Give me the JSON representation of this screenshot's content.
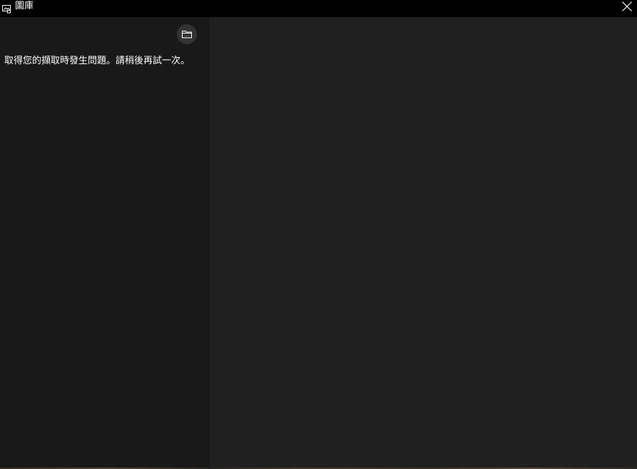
{
  "titlebar": {
    "app_icon": "gallery-app-icon",
    "title": "圖庫",
    "close_icon": "close-icon"
  },
  "left_pane": {
    "folder_button_icon": "folder-icon",
    "error_message": "取得您的擷取時發生問題。請稍後再試一次。"
  },
  "colors": {
    "titlebar_bg": "#000000",
    "left_pane_bg": "#191919",
    "right_pane_bg": "#202020",
    "folder_button_bg": "#333333",
    "text": "#ffffff"
  }
}
